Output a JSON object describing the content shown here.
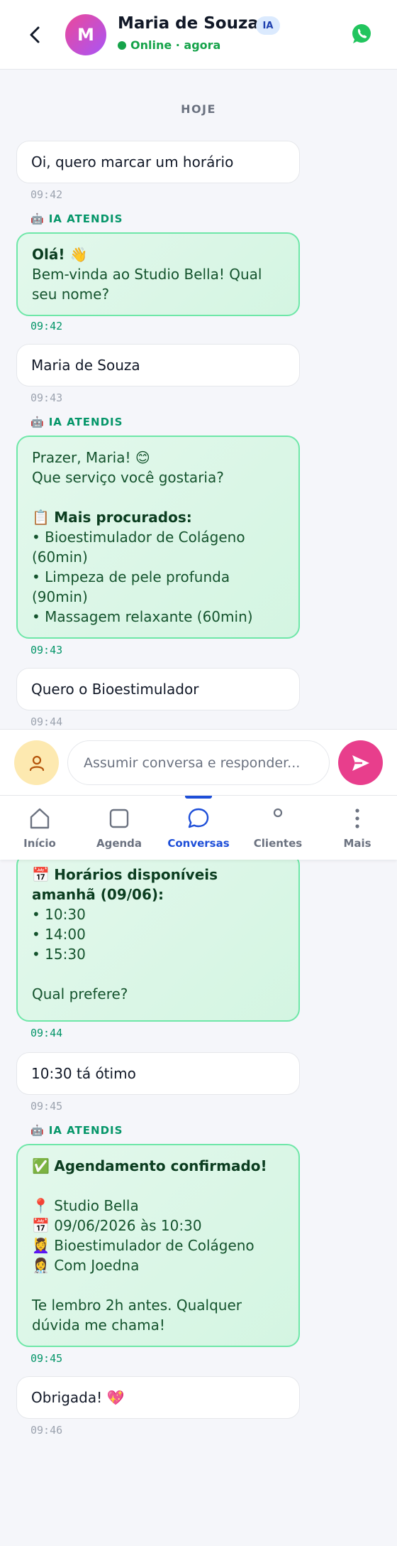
{
  "header": {
    "avatar_initial": "M",
    "contact_name": "Maria de Souza",
    "ia_badge": "IA",
    "status": "Online · agora"
  },
  "date_separator": "HOJE",
  "bot_label": "IA ATENDIS",
  "messages": [
    {
      "sender": "user",
      "lines": [
        {
          "text": "Oi, quero marcar um horário"
        }
      ],
      "time": "09:42"
    },
    {
      "sender": "bot",
      "lines": [
        {
          "text": "Olá! 👋",
          "bold": true
        },
        {
          "text": "Bem-vinda ao Studio Bella! Qual seu nome?"
        }
      ],
      "time": "09:42"
    },
    {
      "sender": "user",
      "lines": [
        {
          "text": "Maria de Souza"
        }
      ],
      "time": "09:43"
    },
    {
      "sender": "bot",
      "lines": [
        {
          "text": "Prazer, Maria! 😊"
        },
        {
          "text": "Que serviço você gostaria?"
        },
        {
          "text": ""
        },
        {
          "text": "📋 ",
          "bold_tail": "Mais procurados:"
        },
        {
          "text": "• Bioestimulador de Colágeno (60min)"
        },
        {
          "text": "• Limpeza de pele profunda (90min)"
        },
        {
          "text": "• Massagem relaxante (60min)"
        }
      ],
      "time": "09:43"
    },
    {
      "sender": "user",
      "lines": [
        {
          "text": "Quero o Bioestimulador"
        }
      ],
      "time": "09:44"
    },
    {
      "sender": "bot",
      "lines": [
        {
          "text": "📅 ",
          "bold_tail": "Horários disponíveis amanhã (09/06):"
        },
        {
          "text": "• 10:30"
        },
        {
          "text": "• 14:00"
        },
        {
          "text": "• 15:30"
        },
        {
          "text": ""
        },
        {
          "text": "Qual prefere?"
        }
      ],
      "time": "09:44"
    },
    {
      "sender": "user",
      "lines": [
        {
          "text": "10:30 tá ótimo"
        }
      ],
      "time": "09:45"
    },
    {
      "sender": "bot",
      "lines": [
        {
          "text": "✅ ",
          "bold_tail": "Agendamento confirmado!"
        },
        {
          "text": ""
        },
        {
          "text": "📍 Studio Bella"
        },
        {
          "text": "📅 09/06/2026 às 10:30"
        },
        {
          "text": "💆‍♀️ Bioestimulador de Colágeno"
        },
        {
          "text": "👩‍⚕️ Com Joedna"
        },
        {
          "text": ""
        },
        {
          "text": "Te lembro 2h antes. Qualquer dúvida me chama!"
        }
      ],
      "time": "09:45"
    },
    {
      "sender": "user",
      "lines": [
        {
          "text": "Obrigada! 💖"
        }
      ],
      "time": "09:46"
    }
  ],
  "composer": {
    "placeholder": "Assumir conversa e responder..."
  },
  "nav": [
    {
      "label": "Início",
      "icon": "home-icon",
      "active": false
    },
    {
      "label": "Agenda",
      "icon": "calendar-icon",
      "active": false
    },
    {
      "label": "Conversas",
      "icon": "chat-icon",
      "active": true
    },
    {
      "label": "Clientes",
      "icon": "users-icon",
      "active": false
    },
    {
      "label": "Mais",
      "icon": "more-icon",
      "active": false
    }
  ],
  "colors": {
    "accent_pink": "#e83e8c",
    "bot_green": "#059669",
    "nav_active": "#1d4ed8",
    "online_green": "#16a34a"
  }
}
